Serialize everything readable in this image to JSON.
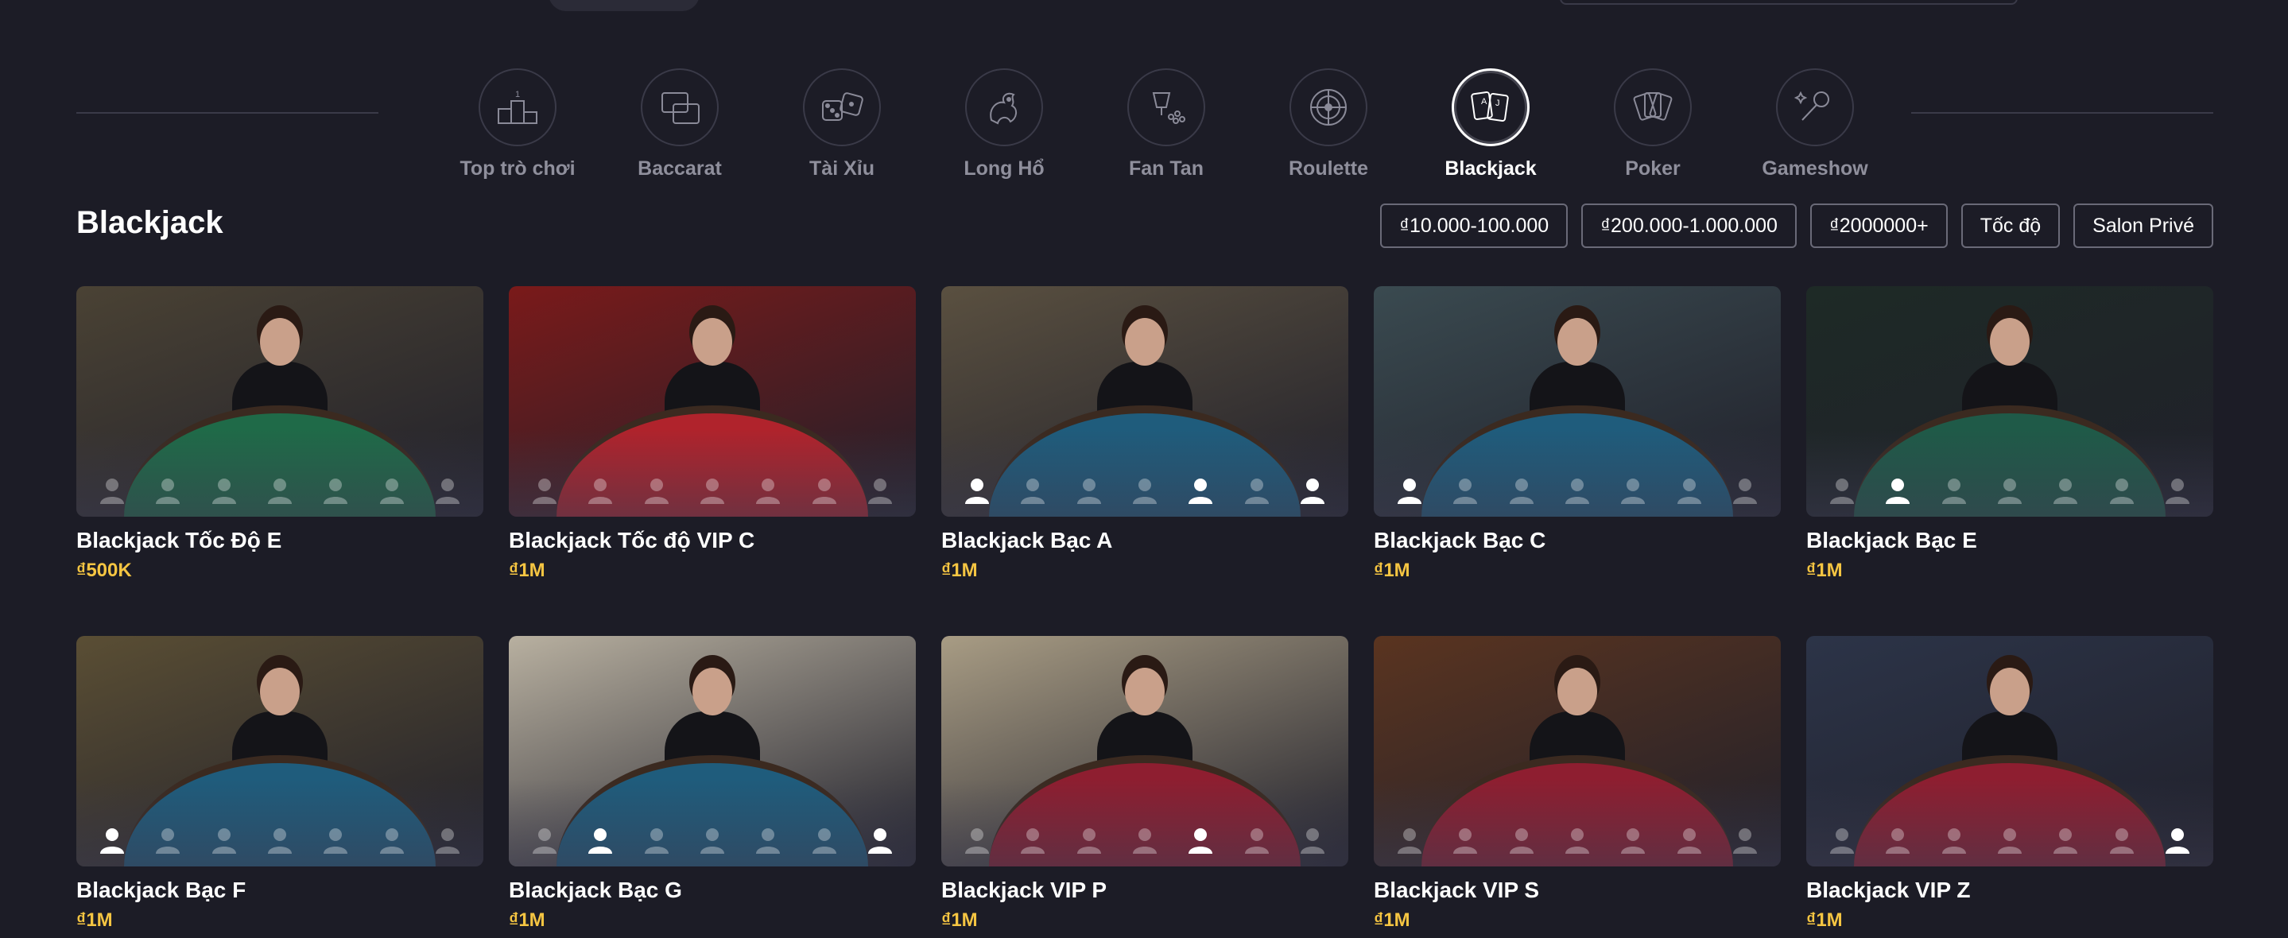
{
  "categories": [
    {
      "label": "Top trò chơi",
      "icon": "podium-icon",
      "active": false
    },
    {
      "label": "Baccarat",
      "icon": "baccarat-cards-icon",
      "active": false
    },
    {
      "label": "Tài Xỉu",
      "icon": "dice-icon",
      "active": false
    },
    {
      "label": "Long Hổ",
      "icon": "dragon-tiger-icon",
      "active": false
    },
    {
      "label": "Fan Tan",
      "icon": "fan-tan-icon",
      "active": false
    },
    {
      "label": "Roulette",
      "icon": "roulette-wheel-icon",
      "active": false
    },
    {
      "label": "Blackjack",
      "icon": "blackjack-cards-icon",
      "active": true
    },
    {
      "label": "Poker",
      "icon": "poker-cards-icon",
      "active": false
    },
    {
      "label": "Gameshow",
      "icon": "microphone-icon",
      "active": false
    }
  ],
  "section": {
    "title": "Blackjack"
  },
  "filters": [
    "₫10.000-100.000",
    "₫200.000-1.000.000",
    "₫2000000+",
    "Tốc độ",
    "Salon Privé"
  ],
  "games": [
    {
      "title": "Blackjack Tốc Độ E",
      "price": "₫500K",
      "felt": "#1f6a48",
      "wall": "#4a4234",
      "seats": [
        0,
        0,
        0,
        0,
        0,
        0,
        0
      ]
    },
    {
      "title": "Blackjack Tốc độ VIP C",
      "price": "₫1M",
      "felt": "#b0232c",
      "wall": "#7a1a1a",
      "seats": [
        0,
        0,
        0,
        0,
        0,
        0,
        0
      ]
    },
    {
      "title": "Blackjack Bạc A",
      "price": "₫1M",
      "felt": "#1f5c7c",
      "wall": "#5a5040",
      "seats": [
        1,
        0,
        0,
        0,
        1,
        0,
        1
      ]
    },
    {
      "title": "Blackjack Bạc C",
      "price": "₫1M",
      "felt": "#1f5c7c",
      "wall": "#3a4a50",
      "seats": [
        1,
        0,
        0,
        0,
        0,
        0,
        0
      ]
    },
    {
      "title": "Blackjack Bạc E",
      "price": "₫1M",
      "felt": "#1f5a48",
      "wall": "#1e2a26",
      "seats": [
        0,
        1,
        0,
        0,
        0,
        0,
        0
      ]
    },
    {
      "title": "Blackjack Bạc F",
      "price": "₫1M",
      "felt": "#1f5c7c",
      "wall": "#5a4e34",
      "seats": [
        1,
        0,
        0,
        0,
        0,
        0,
        0
      ]
    },
    {
      "title": "Blackjack Bạc G",
      "price": "₫1M",
      "felt": "#1f5c7c",
      "wall": "#b8b0a0",
      "seats": [
        0,
        1,
        0,
        0,
        0,
        0,
        1
      ]
    },
    {
      "title": "Blackjack VIP P",
      "price": "₫1M",
      "felt": "#8e1e30",
      "wall": "#a89c84",
      "seats": [
        0,
        0,
        0,
        0,
        1,
        0,
        0
      ]
    },
    {
      "title": "Blackjack VIP S",
      "price": "₫1M",
      "felt": "#8e1e30",
      "wall": "#5a3420",
      "seats": [
        0,
        0,
        0,
        0,
        0,
        0,
        0
      ]
    },
    {
      "title": "Blackjack VIP Z",
      "price": "₫1M",
      "felt": "#8e1e30",
      "wall": "#2c3448",
      "seats": [
        0,
        0,
        0,
        0,
        0,
        0,
        1
      ]
    }
  ]
}
